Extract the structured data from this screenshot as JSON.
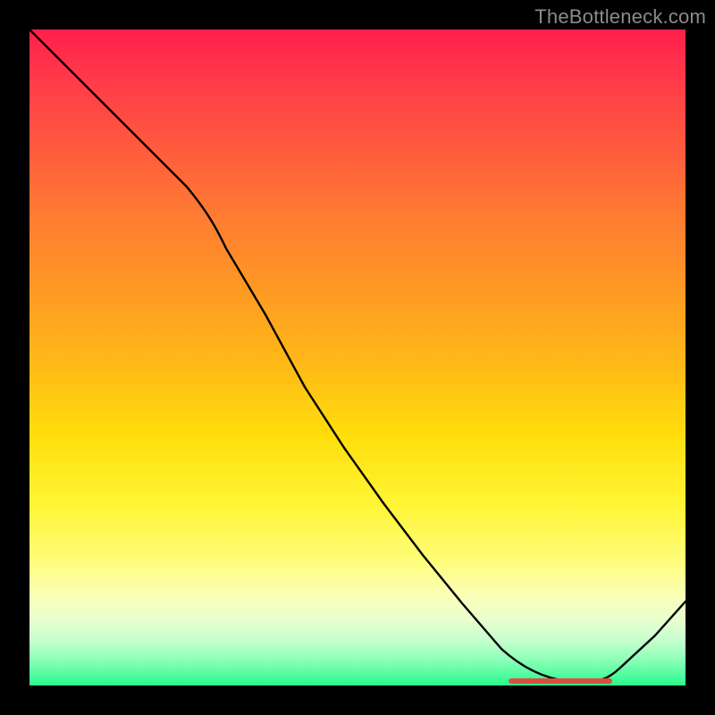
{
  "watermark": "TheBottleneck.com",
  "chart_data": {
    "type": "line",
    "title": "",
    "xlabel": "",
    "ylabel": "",
    "xlim": [
      0,
      100
    ],
    "ylim": [
      0,
      100
    ],
    "gradient_stops": [
      {
        "pos": 0,
        "color": "#ff1f4a"
      },
      {
        "pos": 8,
        "color": "#ff3b49"
      },
      {
        "pos": 18,
        "color": "#ff5a3e"
      },
      {
        "pos": 28,
        "color": "#ff7a32"
      },
      {
        "pos": 40,
        "color": "#ff9a24"
      },
      {
        "pos": 52,
        "color": "#ffbc16"
      },
      {
        "pos": 62,
        "color": "#ffde0c"
      },
      {
        "pos": 72,
        "color": "#fff433"
      },
      {
        "pos": 81,
        "color": "#fffd7a"
      },
      {
        "pos": 86,
        "color": "#fbffb4"
      },
      {
        "pos": 90,
        "color": "#e9ffcf"
      },
      {
        "pos": 93,
        "color": "#c6ffce"
      },
      {
        "pos": 96,
        "color": "#8effb9"
      },
      {
        "pos": 100,
        "color": "#29f98d"
      }
    ],
    "series": [
      {
        "name": "curve",
        "x": [
          0.0,
          6.0,
          12.0,
          18.0,
          24.0,
          30.0,
          36.0,
          42.0,
          48.0,
          54.0,
          60.0,
          66.0,
          72.0,
          78.0,
          84.0,
          88.0,
          92.0,
          96.0,
          100.0
        ],
        "values": [
          100.0,
          94.0,
          88.0,
          82.0,
          76.0,
          70.5,
          62.0,
          53.5,
          45.0,
          36.5,
          28.0,
          20.0,
          12.0,
          5.0,
          0.5,
          0.0,
          3.5,
          8.0,
          13.0
        ]
      }
    ],
    "marker_band": {
      "x_start": 73.0,
      "x_end": 89.0,
      "y": 0.5
    }
  }
}
